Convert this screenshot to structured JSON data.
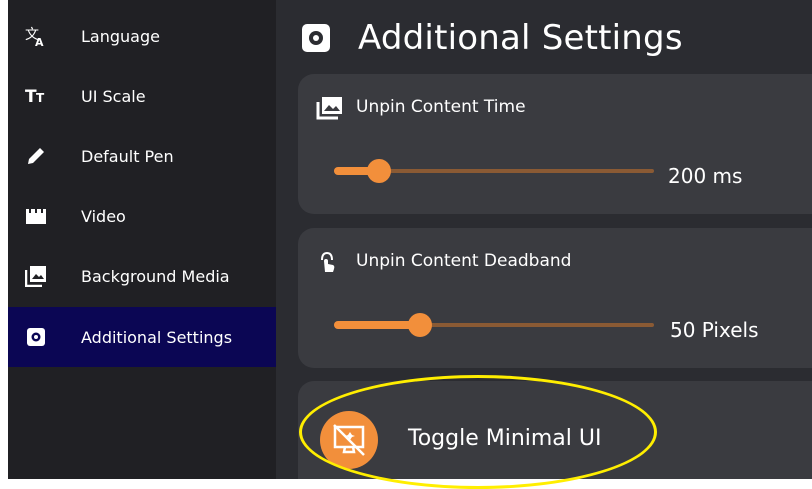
{
  "sidebar": {
    "items": [
      {
        "label": "Language",
        "icon": "translate-icon"
      },
      {
        "label": "UI Scale",
        "icon": "text-size-icon"
      },
      {
        "label": "Default Pen",
        "icon": "pen-icon"
      },
      {
        "label": "Video",
        "icon": "clapperboard-icon"
      },
      {
        "label": "Background Media",
        "icon": "image-stack-icon"
      },
      {
        "label": "Additional Settings",
        "icon": "gear-icon",
        "active": true
      }
    ]
  },
  "main": {
    "title": "Additional Settings",
    "cards": [
      {
        "label": "Unpin Content Time",
        "value": "200 ms",
        "slider_fraction": 0.14
      },
      {
        "label": "Unpin Content Deadband",
        "value": "50 Pixels",
        "slider_fraction": 0.27
      }
    ],
    "toggle": {
      "label": "Toggle Minimal UI"
    }
  },
  "colors": {
    "accent": "#f28f3b",
    "sidebar_active": "#0b0654",
    "highlight": "#ffee00"
  }
}
